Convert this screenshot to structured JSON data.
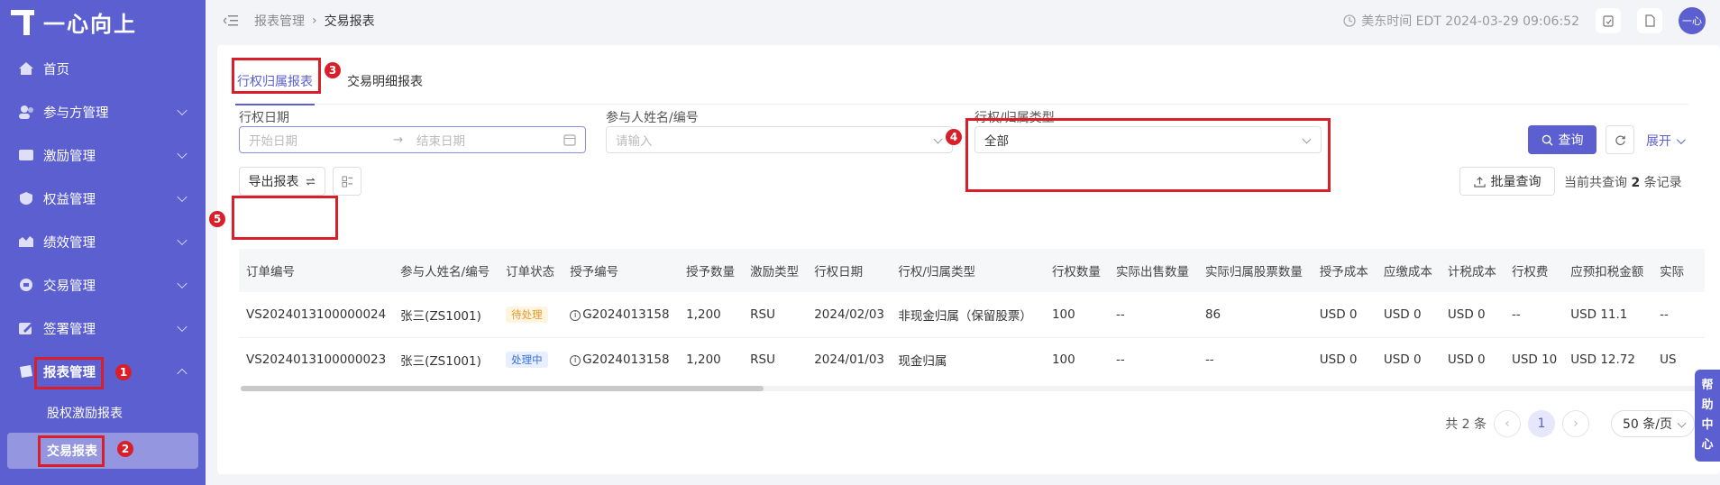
{
  "app": {
    "logo_text": "一心向上"
  },
  "sidebar": {
    "items": [
      {
        "label": "首页",
        "icon": "home-icon"
      },
      {
        "label": "参与方管理",
        "icon": "users-icon"
      },
      {
        "label": "激励管理",
        "icon": "incentive-icon"
      },
      {
        "label": "权益管理",
        "icon": "equity-icon"
      },
      {
        "label": "绩效管理",
        "icon": "performance-icon"
      },
      {
        "label": "交易管理",
        "icon": "trade-icon"
      },
      {
        "label": "签署管理",
        "icon": "sign-icon"
      },
      {
        "label": "报表管理",
        "icon": "report-icon"
      }
    ],
    "subitems": [
      {
        "label": "股权激励报表"
      },
      {
        "label": "交易报表"
      }
    ]
  },
  "header": {
    "breadcrumb": [
      "报表管理",
      "交易报表"
    ],
    "time": "美东时间 EDT 2024-03-29 09:06:52",
    "avatar_text": "一心"
  },
  "tabs": [
    {
      "label": "行权归属报表"
    },
    {
      "label": "交易明细报表"
    }
  ],
  "filters": {
    "date_label": "行权日期",
    "date_start_placeholder": "开始日期",
    "date_end_placeholder": "结束日期",
    "date_sep": "→",
    "participant_label": "参与人姓名/编号",
    "participant_placeholder": "请输入",
    "type_label": "行权/归属类型",
    "type_value": "全部",
    "search_label": "查询",
    "expand_label": "展开"
  },
  "toolbar": {
    "export_label": "导出报表",
    "batch_label": "批量查询",
    "record_prefix": "当前共查询",
    "record_count": "2",
    "record_suffix": "条记录"
  },
  "table": {
    "columns": [
      "订单编号",
      "参与人姓名/编号",
      "订单状态",
      "授予编号",
      "授予数量",
      "激励类型",
      "行权日期",
      "行权/归属类型",
      "行权数量",
      "实际出售数量",
      "实际归属股票数量",
      "授予成本",
      "应缴成本",
      "计税成本",
      "行权费",
      "应预扣税金额",
      "实际"
    ],
    "rows": [
      [
        "VS2024013100000024",
        "张三(ZS1001)",
        "待处理",
        "G2024013158",
        "1,200",
        "RSU",
        "2024/02/03",
        "非现金归属（保留股票）",
        "100",
        "--",
        "86",
        "USD 0",
        "USD 0",
        "USD 0",
        "--",
        "USD 11.1",
        "--"
      ],
      [
        "VS2024013100000023",
        "张三(ZS1001)",
        "处理中",
        "G2024013158",
        "1,200",
        "RSU",
        "2024/01/03",
        "现金归属",
        "100",
        "--",
        "--",
        "USD 0",
        "USD 0",
        "USD 0",
        "USD 10",
        "USD 12.72",
        "US"
      ]
    ]
  },
  "pagination": {
    "total_text": "共 2 条",
    "current_page": "1",
    "page_size": "50 条/页"
  },
  "help": {
    "chars": [
      "帮",
      "助",
      "中",
      "心"
    ]
  },
  "annotations": [
    "1",
    "2",
    "3",
    "4",
    "5"
  ],
  "colors": {
    "brand": "#5b5fcf",
    "annotation": "#d9202a"
  }
}
